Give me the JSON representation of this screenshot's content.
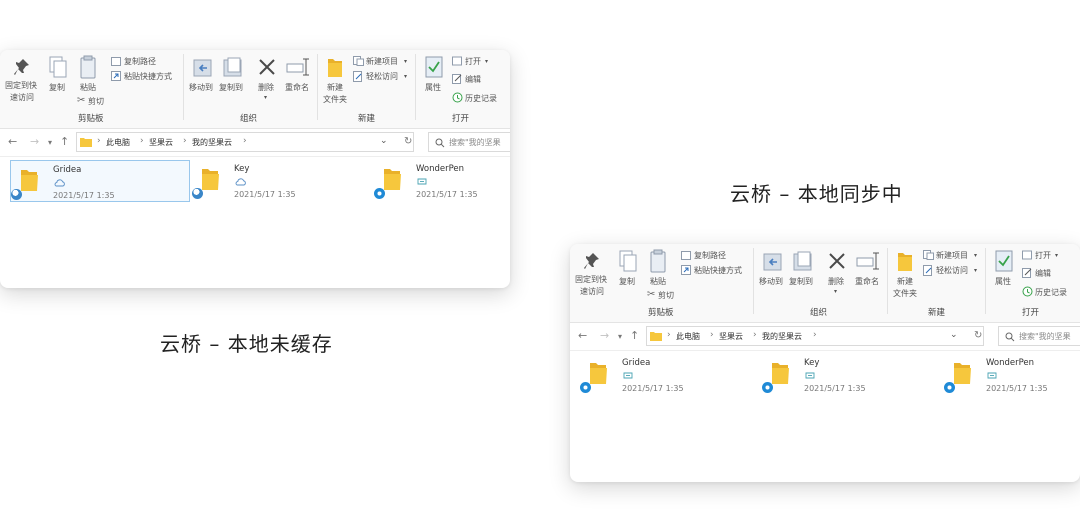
{
  "captions": {
    "uncached": "云桥 – 本地未缓存",
    "syncing": "云桥 – 本地同步中"
  },
  "ribbon": {
    "pin_line1": "固定到快",
    "pin_line2": "速访问",
    "copy": "复制",
    "paste": "粘贴",
    "copy_path": "复制路径",
    "paste_shortcut": "粘贴快捷方式",
    "cut": "剪切",
    "clipboard_group": "剪贴板",
    "move_to": "移动到",
    "copy_to": "复制到",
    "delete": "删除",
    "rename": "重命名",
    "organize_group": "组织",
    "new_item": "新建项目",
    "easy_access": "轻松访问",
    "new_folder_line1": "新建",
    "new_folder_line2": "文件夹",
    "new_group": "新建",
    "properties": "属性",
    "open": "打开",
    "edit": "编辑",
    "history": "历史记录",
    "open_group": "打开"
  },
  "address": {
    "crumbs": [
      "此电脑",
      "坚果云",
      "我的坚果云"
    ],
    "sep": "›",
    "search_placeholder": "搜索\"我的坚果"
  },
  "files": [
    {
      "name": "Gridea",
      "date": "2021/5/17 1:35"
    },
    {
      "name": "Key",
      "date": "2021/5/17 1:35"
    },
    {
      "name": "WonderPen",
      "date": "2021/5/17 1:35"
    }
  ],
  "colors": {
    "folder": "#f6c73d",
    "folder_back": "#e9b12a",
    "sync_badge": "#1f8ad6",
    "cloud_badge": "#3a86c8",
    "selection": "#99c7ec",
    "status_green": "#37a24a"
  },
  "icons": [
    "pin-icon",
    "copy-icon",
    "paste-icon",
    "cut-icon",
    "move-to-icon",
    "copy-to-icon",
    "delete-icon",
    "rename-icon",
    "new-folder-icon",
    "properties-icon",
    "folder-icon",
    "cloud-icon",
    "sync-icon",
    "search-icon",
    "refresh-icon"
  ]
}
